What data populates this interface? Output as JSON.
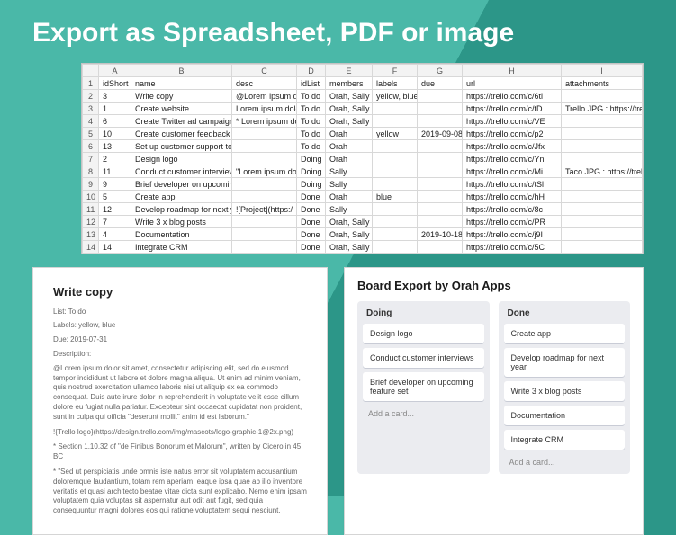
{
  "heading": "Export as Spreadsheet, PDF or image",
  "sheet": {
    "cols": [
      "A",
      "B",
      "C",
      "D",
      "E",
      "F",
      "G",
      "H",
      "I"
    ],
    "headers": [
      "idShort",
      "name",
      "desc",
      "idList",
      "members",
      "labels",
      "due",
      "url",
      "attachments"
    ],
    "rows": [
      {
        "n": 1,
        "c": [
          "3",
          "Write copy",
          "@Lorem ipsum do",
          "To do",
          "Orah, Sally",
          "yellow, blue",
          "",
          "https://trello.com/c/6tl",
          ""
        ]
      },
      {
        "n": 2,
        "c": [
          "1",
          "Create website",
          "Lorem ipsum dolo",
          "To do",
          "Orah, Sally",
          "",
          "",
          "https://trello.com/c/tD",
          "Trello.JPG : https://trello-"
        ]
      },
      {
        "n": 3,
        "c": [
          "6",
          "Create Twitter ad campaign",
          "* Lorem ipsum do",
          "To do",
          "Orah, Sally",
          "",
          "",
          "https://trello.com/c/VE",
          ""
        ]
      },
      {
        "n": 4,
        "c": [
          "10",
          "Create customer feedback fo",
          "",
          "To do",
          "Orah",
          "yellow",
          "2019-09-08",
          "https://trello.com/c/p2",
          ""
        ]
      },
      {
        "n": 5,
        "c": [
          "13",
          "Set up customer support tool",
          "",
          "To do",
          "Orah",
          "",
          "",
          "https://trello.com/c/Jfx",
          ""
        ]
      },
      {
        "n": 6,
        "c": [
          "2",
          "Design logo",
          "",
          "Doing",
          "Orah",
          "",
          "",
          "https://trello.com/c/Yn",
          ""
        ]
      },
      {
        "n": 7,
        "c": [
          "11",
          "Conduct customer interviews",
          "\"Lorem ipsum do",
          "Doing",
          "Sally",
          "",
          "",
          "https://trello.com/c/Mi",
          "Taco.JPG : https://trello-a"
        ]
      },
      {
        "n": 8,
        "c": [
          "9",
          "Brief developer on upcoming",
          "",
          "Doing",
          "Sally",
          "",
          "",
          "https://trello.com/c/tSl",
          ""
        ]
      },
      {
        "n": 9,
        "c": [
          "5",
          "Create app",
          "",
          "Done",
          "Orah",
          "blue",
          "",
          "https://trello.com/c/hH",
          ""
        ]
      },
      {
        "n": 10,
        "c": [
          "12",
          "Develop roadmap for next ye",
          "![Project](https:/",
          "Done",
          "Sally",
          "",
          "",
          "https://trello.com/c/8c",
          ""
        ]
      },
      {
        "n": 11,
        "c": [
          "7",
          "Write 3 x blog posts",
          "",
          "Done",
          "Orah, Sally",
          "",
          "",
          "https://trello.com/c/PR",
          ""
        ]
      },
      {
        "n": 12,
        "c": [
          "4",
          "Documentation",
          "",
          "Done",
          "Orah, Sally",
          "",
          "2019-10-18",
          "https://trello.com/c/j9I",
          ""
        ]
      },
      {
        "n": 13,
        "c": [
          "14",
          "Integrate CRM",
          "",
          "Done",
          "Orah, Sally",
          "",
          "",
          "https://trello.com/c/5C",
          ""
        ]
      }
    ]
  },
  "pdf": {
    "title": "Write copy",
    "list": "List: To do",
    "labels": "Labels: yellow, blue",
    "due": "Due: 2019-07-31",
    "desc_label": "Description:",
    "p1": "@Lorem ipsum dolor sit amet, consectetur adipiscing elit, sed do eiusmod tempor incididunt ut labore et dolore magna aliqua. Ut enim ad minim veniam, quis nostrud exercitation ullamco laboris nisi ut aliquip ex ea commodo consequat. Duis aute irure dolor in reprehenderit in voluptate velit esse cillum dolore eu fugiat nulla pariatur. Excepteur sint occaecat cupidatat non proident, sunt in culpa qui officia \"deserunt mollit\" anim id est laborum.\"",
    "p2": "!{Trello logo}(https://design.trello.com/img/mascots/logo-graphic-1@2x.png)",
    "p3": "* Section 1.10.32 of \"de Finibus Bonorum et Malorum\", written by Cicero in 45 BC",
    "p4": "* \"Sed ut perspiciatis unde omnis iste natus error sit voluptatem accusantium doloremque laudantium, totam rem aperiam, eaque ipsa quae ab illo inventore veritatis et quasi architecto beatae vitae dicta sunt explicabo. Nemo enim ipsam voluptatem quia voluptas sit aspernatur aut odit aut fugit, sed quia consequuntur magni dolores eos qui ratione voluptatem sequi nesciunt."
  },
  "board": {
    "title": "Board Export by Orah Apps",
    "add": "Add a card...",
    "lists": [
      {
        "name": "Doing",
        "cards": [
          "Design logo",
          "Conduct customer interviews",
          "Brief developer on upcoming feature set"
        ]
      },
      {
        "name": "Done",
        "cards": [
          "Create app",
          "Develop roadmap for next year",
          "Write 3 x blog posts",
          "Documentation",
          "Integrate CRM"
        ]
      }
    ]
  }
}
